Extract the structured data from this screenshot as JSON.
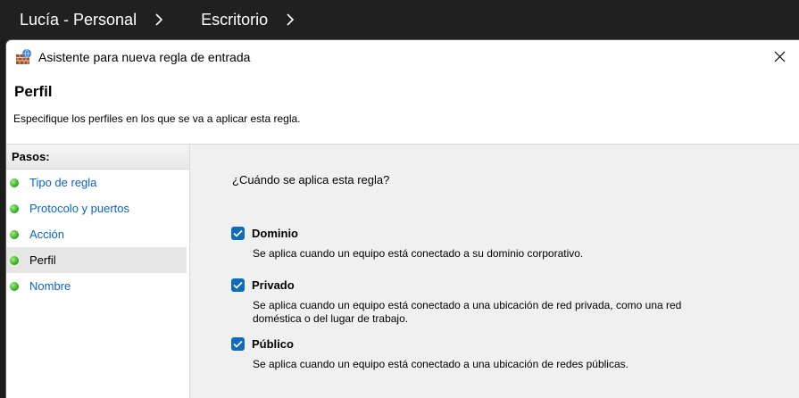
{
  "explorer": {
    "breadcrumb": [
      "Lucía - Personal",
      "Escritorio"
    ]
  },
  "window": {
    "title": "Asistente para nueva regla de entrada",
    "icon": "firewall-icon"
  },
  "header": {
    "title": "Perfil",
    "description": "Especifique los perfiles en los que se va a aplicar esta regla."
  },
  "steps": {
    "heading": "Pasos:",
    "items": [
      {
        "label": "Tipo de regla",
        "current": false
      },
      {
        "label": "Protocolo y puertos",
        "current": false
      },
      {
        "label": "Acción",
        "current": false
      },
      {
        "label": "Perfil",
        "current": true
      },
      {
        "label": "Nombre",
        "current": false
      }
    ]
  },
  "content": {
    "question": "¿Cuándo se aplica esta regla?",
    "profiles": [
      {
        "label": "Dominio",
        "checked": true,
        "description": "Se aplica cuando un equipo está conectado a su dominio corporativo."
      },
      {
        "label": "Privado",
        "checked": true,
        "description": "Se aplica cuando un equipo está conectado a una ubicación de red privada, como una red doméstica o del lugar de trabajo."
      },
      {
        "label": "Público",
        "checked": true,
        "description": "Se aplica cuando un equipo está conectado a una ubicación de redes públicas."
      }
    ]
  },
  "colors": {
    "accent": "#0f6cbd",
    "link": "#0b63c6",
    "step_dot": "#3fb52a"
  }
}
